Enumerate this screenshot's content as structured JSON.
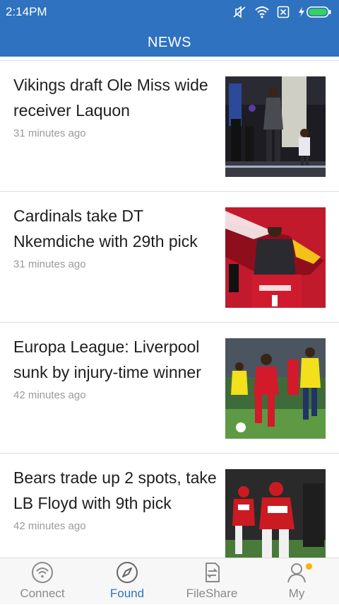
{
  "status_bar": {
    "time": "2:14PM"
  },
  "header": {
    "title": "NEWS"
  },
  "feed": {
    "items": [
      {
        "headline": "Vikings draft Ole Miss wide receiver Laquon",
        "time": "31 minutes ago"
      },
      {
        "headline": "Cardinals take DT Nkemdiche with 29th pick",
        "time": "31 minutes ago"
      },
      {
        "headline": "Europa League: Liverpool sunk by injury-time winner",
        "time": "42 minutes ago"
      },
      {
        "headline": "Bears trade up 2 spots, take LB Floyd with 9th pick",
        "time": "42 minutes ago"
      }
    ]
  },
  "bottom_nav": {
    "items": [
      {
        "label": "Connect",
        "icon": "wifi-icon"
      },
      {
        "label": "Found",
        "icon": "compass-icon"
      },
      {
        "label": "FileShare",
        "icon": "file-share-icon"
      },
      {
        "label": "My",
        "icon": "profile-icon"
      }
    ],
    "active_index": 1
  },
  "colors": {
    "accent": "#2f72bf",
    "notification_dot": "#f5b400"
  }
}
